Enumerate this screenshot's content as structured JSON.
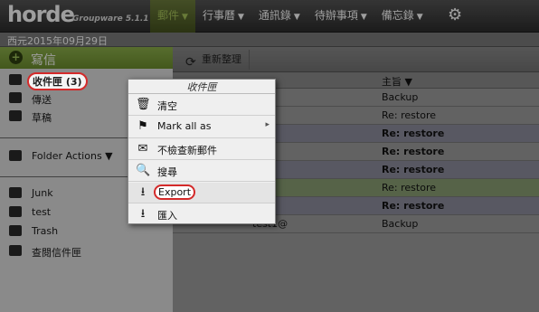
{
  "app": {
    "logo": "horde",
    "subtitle": "Groupware 5.1.1"
  },
  "menu": [
    {
      "label": "郵件",
      "active": true
    },
    {
      "label": "行事曆",
      "active": false
    },
    {
      "label": "通訊錄",
      "active": false
    },
    {
      "label": "待辦事項",
      "active": false
    },
    {
      "label": "備忘錄",
      "active": false
    }
  ],
  "date": "西元2015年09月29日",
  "sidebar": {
    "compose": "寫信",
    "folders": [
      {
        "label": "收件匣",
        "count": "(3)"
      },
      {
        "label": "傳送"
      },
      {
        "label": "草稿"
      }
    ],
    "folder_actions": "Folder Actions",
    "other_folders": [
      {
        "label": "Junk"
      },
      {
        "label": "test"
      },
      {
        "label": "Trash"
      },
      {
        "label": "查閱信件匣"
      }
    ]
  },
  "toolbar": {
    "refresh": "重新整理"
  },
  "columns": {
    "subject": "主旨"
  },
  "messages": [
    {
      "from": "",
      "subject": "Backup",
      "unread": false,
      "style": "plain"
    },
    {
      "from": "",
      "subject": "Re: restore",
      "unread": false,
      "style": "plain"
    },
    {
      "from": "",
      "subject": "Re: restore",
      "unread": true,
      "style": "alt"
    },
    {
      "from": "",
      "subject": "Re: restore",
      "unread": true,
      "style": "plain"
    },
    {
      "from": "",
      "subject": "Re: restore",
      "unread": true,
      "style": "alt"
    },
    {
      "from": "",
      "subject": "Re: restore",
      "unread": false,
      "style": "green"
    },
    {
      "from": "",
      "subject": "Re: restore",
      "unread": true,
      "style": "alt"
    },
    {
      "from": "test1@",
      "subject": "Backup",
      "unread": false,
      "style": "plain"
    }
  ],
  "context_menu": {
    "title": "收件匣",
    "items": [
      {
        "label": "清空",
        "icon": "trash-icon"
      },
      {
        "label": "Mark all as",
        "icon": "flag-icon",
        "submenu": "▸"
      },
      {
        "label": "不檢查新郵件",
        "icon": "envelope-icon"
      },
      {
        "label": "搜尋",
        "icon": "search-icon"
      },
      {
        "label": "Export",
        "icon": "download-icon",
        "highlight": true
      },
      {
        "label": "匯入",
        "icon": "upload-icon"
      }
    ]
  },
  "colors": {
    "accent": "#8db04a",
    "highlight_ring": "#d42a2a"
  }
}
